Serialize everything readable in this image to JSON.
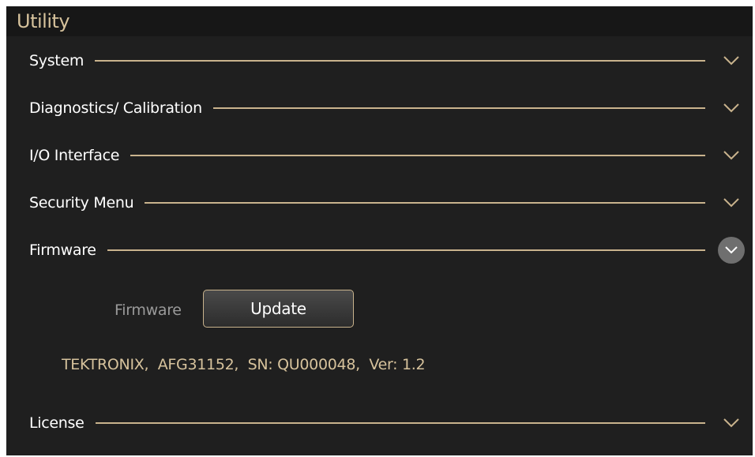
{
  "window": {
    "title": "Utility"
  },
  "sections": [
    {
      "label": "System",
      "expanded": false
    },
    {
      "label": "Diagnostics/ Calibration",
      "expanded": false
    },
    {
      "label": "I/O Interface",
      "expanded": false
    },
    {
      "label": "Security Menu",
      "expanded": false
    },
    {
      "label": "Firmware",
      "expanded": true
    },
    {
      "label": "License",
      "expanded": false
    }
  ],
  "firmware": {
    "field_label": "Firmware",
    "update_button": "Update",
    "info": "TEKTRONIX,  AFG31152,  SN: QU000048,  Ver: 1.2"
  },
  "colors": {
    "accent": "#c9b38d",
    "title_text": "#d6c29c",
    "background": "#1f1f1f",
    "active_chevron_bg": "#6f6f6f"
  },
  "icons": {
    "collapsed": "chevron-down-icon"
  }
}
